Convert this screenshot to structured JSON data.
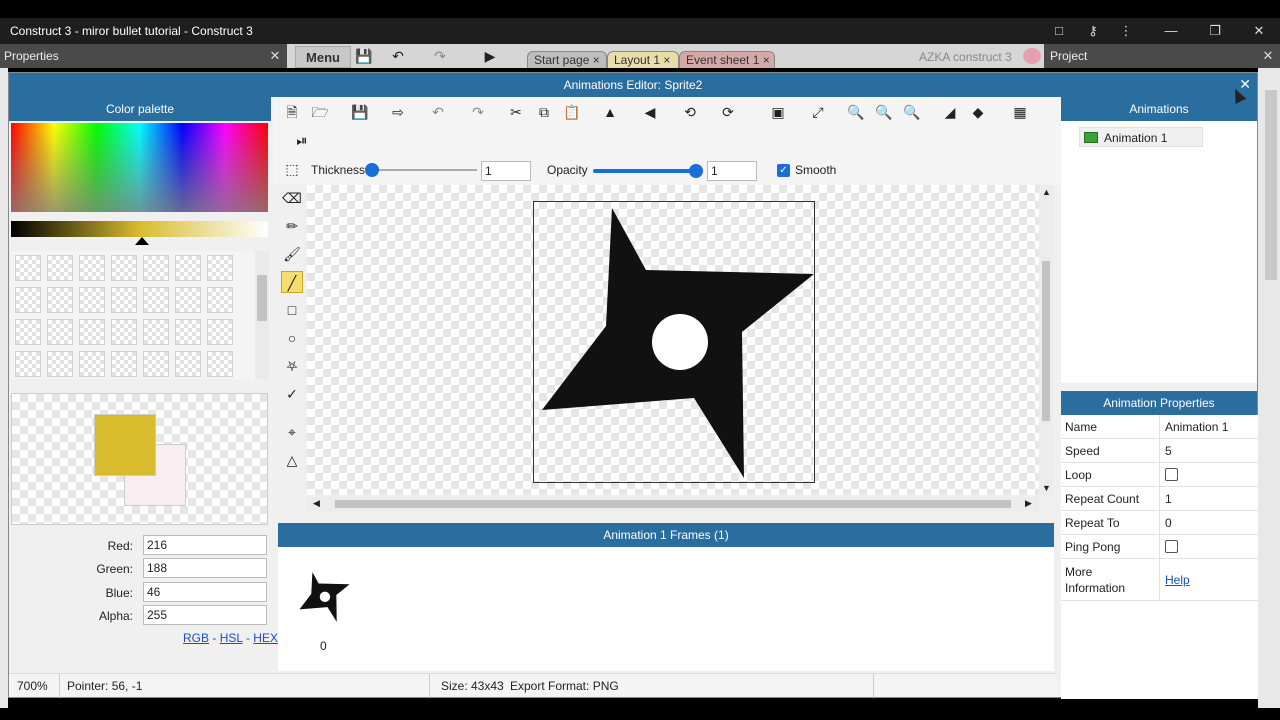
{
  "window": {
    "title": "Construct 3 - miror bullet tutorial - Construct 3"
  },
  "panels": {
    "properties": "Properties",
    "project": "Project"
  },
  "menu": {
    "label": "Menu"
  },
  "tabs": [
    {
      "label": "Start page"
    },
    {
      "label": "Layout 1"
    },
    {
      "label": "Event sheet 1"
    }
  ],
  "user": {
    "name": "AZKA construct 3"
  },
  "dialog": {
    "title": "Animations Editor: Sprite2"
  },
  "color_palette": {
    "title": "Color palette",
    "labels": {
      "red": "Red:",
      "green": "Green:",
      "blue": "Blue:",
      "alpha": "Alpha:"
    },
    "values": {
      "red": "216",
      "green": "188",
      "blue": "46",
      "alpha": "255"
    },
    "links": {
      "rgb": "RGB",
      "hsl": "HSL",
      "hex": "HEX",
      "sep": "-"
    },
    "primary_color": "#d8bc2e",
    "secondary_color": "#f8eef2"
  },
  "toolbar": {
    "thickness_label": "Thickness",
    "thickness_value": "1",
    "opacity_label": "Opacity",
    "opacity_value": "1",
    "smooth_label": "Smooth",
    "smooth_checked": true
  },
  "frames": {
    "header": "Animation 1 Frames (1)",
    "items": [
      {
        "index": "0"
      }
    ]
  },
  "animations": {
    "header": "Animations",
    "items": [
      {
        "label": "Animation 1"
      }
    ]
  },
  "animation_properties": {
    "header": "Animation Properties",
    "rows": {
      "name": {
        "label": "Name",
        "value": "Animation 1"
      },
      "speed": {
        "label": "Speed",
        "value": "5"
      },
      "loop": {
        "label": "Loop"
      },
      "repeat_count": {
        "label": "Repeat Count",
        "value": "1"
      },
      "repeat_to": {
        "label": "Repeat To",
        "value": "0"
      },
      "ping_pong": {
        "label": "Ping Pong"
      },
      "more_info": {
        "label_1": "More",
        "label_2": "Information",
        "link": "Help"
      }
    }
  },
  "status": {
    "zoom": "700%",
    "pointer": "Pointer: 56, -1",
    "size": "Size: 43x43",
    "export": "Export Format: PNG"
  },
  "colors": {
    "accent": "#2a6ea0",
    "titlebar": "#1e1e1e",
    "tabstrip": "#4a4a4a"
  }
}
